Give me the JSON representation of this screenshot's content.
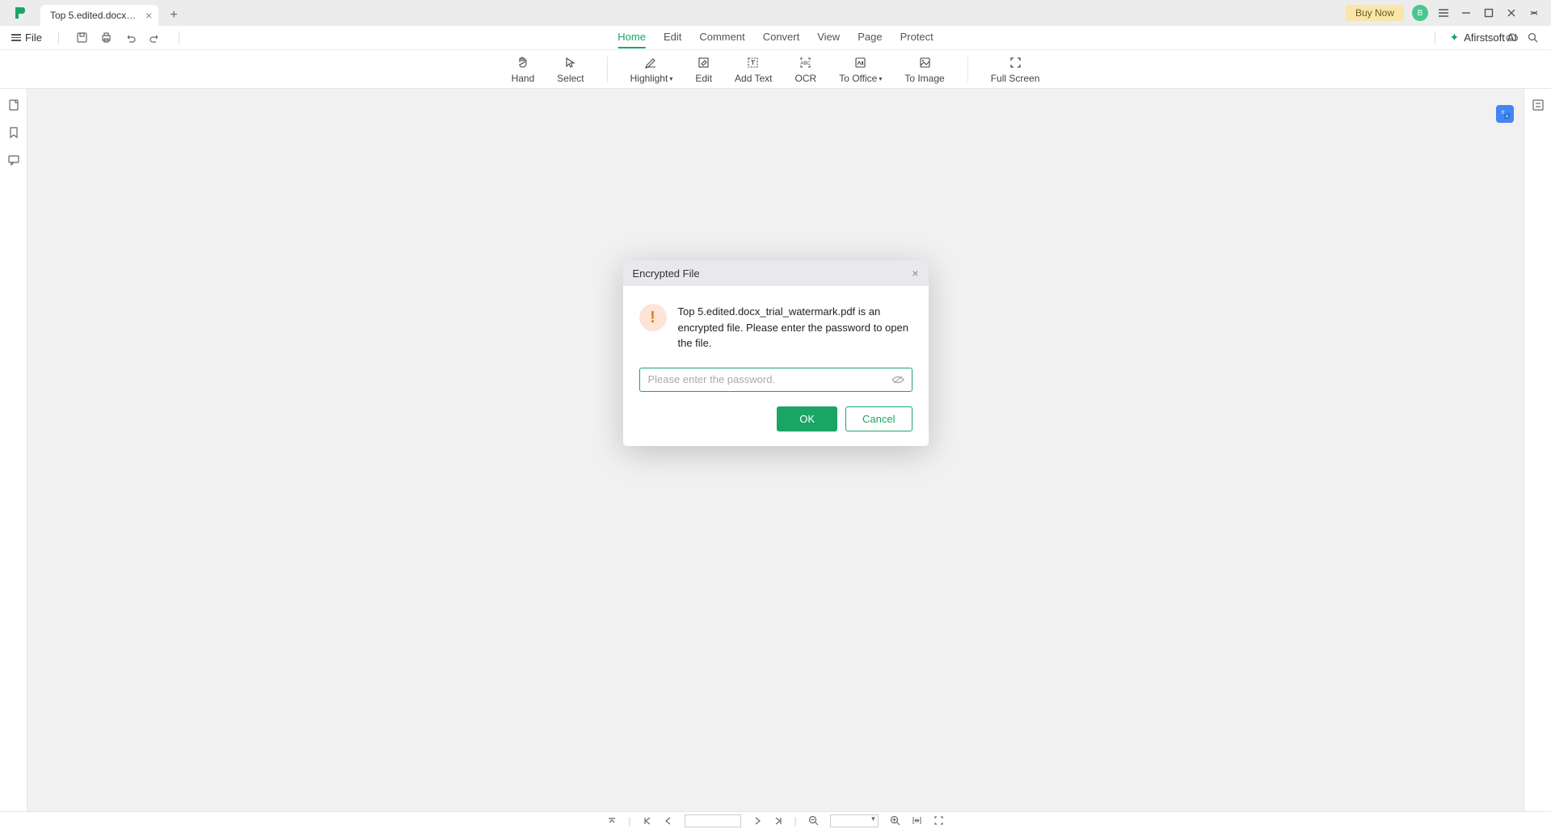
{
  "title_bar": {
    "tab_title": "Top 5.edited.docx_trial_...",
    "buy_now": "Buy Now"
  },
  "menu_bar": {
    "file": "File",
    "tabs": [
      "Home",
      "Edit",
      "Comment",
      "Convert",
      "View",
      "Page",
      "Protect"
    ],
    "active_tab_index": 0,
    "ai_label": "Afirstsoft AI"
  },
  "toolbar": {
    "hand": "Hand",
    "select": "Select",
    "highlight": "Highlight",
    "edit": "Edit",
    "add_text": "Add Text",
    "ocr": "OCR",
    "to_office": "To Office",
    "to_image": "To Image",
    "full_screen": "Full Screen"
  },
  "dialog": {
    "title": "Encrypted File",
    "message": "Top 5.edited.docx_trial_watermark.pdf is an encrypted file. Please enter the password to open the file.",
    "placeholder": "Please enter the password.",
    "ok": "OK",
    "cancel": "Cancel"
  }
}
